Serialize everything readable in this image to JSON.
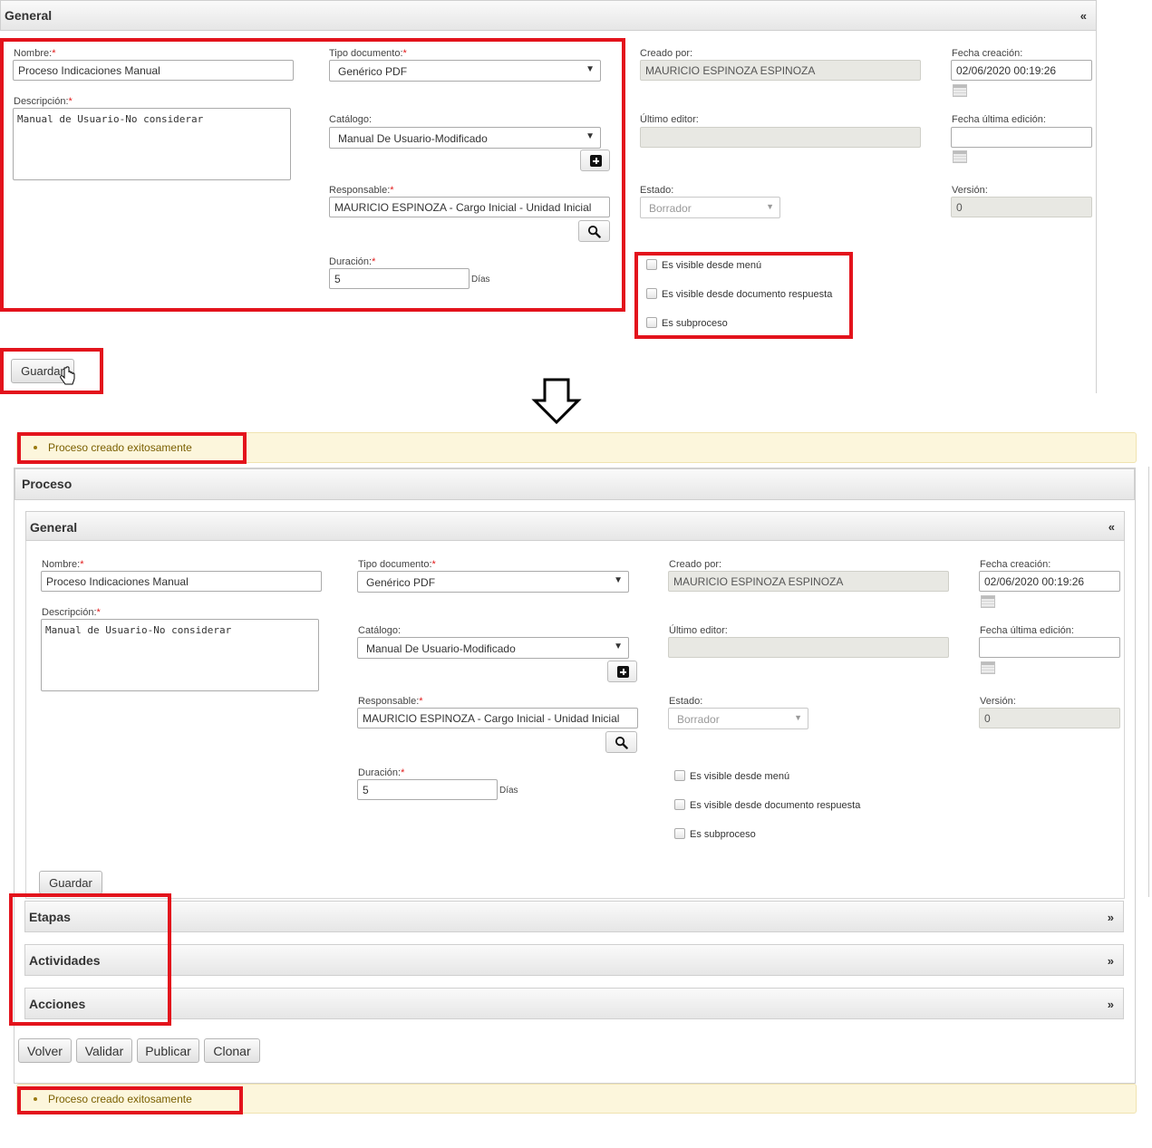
{
  "top_form": {
    "section_title": "General",
    "collapse_icon": "«",
    "nombre": {
      "label": "Nombre:",
      "value": "Proceso Indicaciones Manual"
    },
    "descripcion": {
      "label": "Descripción:",
      "value": "Manual de Usuario-No considerar"
    },
    "tipo_documento": {
      "label": "Tipo documento:",
      "value": "Genérico PDF"
    },
    "catalogo": {
      "label": "Catálogo:",
      "value": "Manual De Usuario-Modificado"
    },
    "responsable": {
      "label": "Responsable:",
      "value": "MAURICIO ESPINOZA - Cargo Inicial - Unidad Inicial"
    },
    "duracion": {
      "label": "Duración:",
      "value": "5",
      "unit": "Días"
    },
    "creado_por": {
      "label": "Creado por:",
      "value": "MAURICIO ESPINOZA ESPINOZA"
    },
    "fecha_creacion": {
      "label": "Fecha creación:",
      "value": "02/06/2020 00:19:26"
    },
    "ultimo_editor": {
      "label": "Último editor:",
      "value": ""
    },
    "fecha_ultima_edicion": {
      "label": "Fecha última edición:",
      "value": ""
    },
    "estado": {
      "label": "Estado:",
      "value": "Borrador"
    },
    "version": {
      "label": "Versión:",
      "value": "0"
    },
    "checkboxes": [
      {
        "label": "Es visible desde menú",
        "checked": false
      },
      {
        "label": "Es visible desde documento respuesta",
        "checked": false
      },
      {
        "label": "Es subproceso",
        "checked": false
      }
    ],
    "save_label": "Guardar",
    "required_mark": "*"
  },
  "arrow": "down-arrow-icon",
  "bottom_page": {
    "success_message": "Proceso creado exitosamente",
    "proceso_title": "Proceso",
    "general": {
      "section_title": "General",
      "collapse_icon": "«",
      "nombre": {
        "label": "Nombre:",
        "value": "Proceso Indicaciones Manual"
      },
      "descripcion": {
        "label": "Descripción:",
        "value": "Manual de Usuario-No considerar"
      },
      "tipo_documento": {
        "label": "Tipo documento:",
        "value": "Genérico PDF"
      },
      "catalogo": {
        "label": "Catálogo:",
        "value": "Manual De Usuario-Modificado"
      },
      "responsable": {
        "label": "Responsable:",
        "value": "MAURICIO ESPINOZA - Cargo Inicial - Unidad Inicial"
      },
      "duracion": {
        "label": "Duración:",
        "value": "5",
        "unit": "Días"
      },
      "creado_por": {
        "label": "Creado por:",
        "value": "MAURICIO ESPINOZA ESPINOZA"
      },
      "fecha_creacion": {
        "label": "Fecha creación:",
        "value": "02/06/2020 00:19:26"
      },
      "ultimo_editor": {
        "label": "Último editor:",
        "value": ""
      },
      "fecha_ultima_edicion": {
        "label": "Fecha última edición:",
        "value": ""
      },
      "estado": {
        "label": "Estado:",
        "value": "Borrador"
      },
      "version": {
        "label": "Versión:",
        "value": "0"
      },
      "checkboxes": [
        {
          "label": "Es visible desde menú",
          "checked": false
        },
        {
          "label": "Es visible desde documento respuesta",
          "checked": false
        },
        {
          "label": "Es subproceso",
          "checked": false
        }
      ],
      "save_label": "Guardar"
    },
    "sections": [
      {
        "title": "Etapas",
        "expand_icon": "»"
      },
      {
        "title": "Actividades",
        "expand_icon": "»"
      },
      {
        "title": "Acciones",
        "expand_icon": "»"
      }
    ],
    "actions": [
      "Volver",
      "Validar",
      "Publicar",
      "Clonar"
    ],
    "bottom_message": "Proceso creado exitosamente"
  },
  "colors": {
    "highlight_red": "#e3131c",
    "message_bg": "#fcf6dc",
    "readonly_bg": "#e8e8e3"
  }
}
